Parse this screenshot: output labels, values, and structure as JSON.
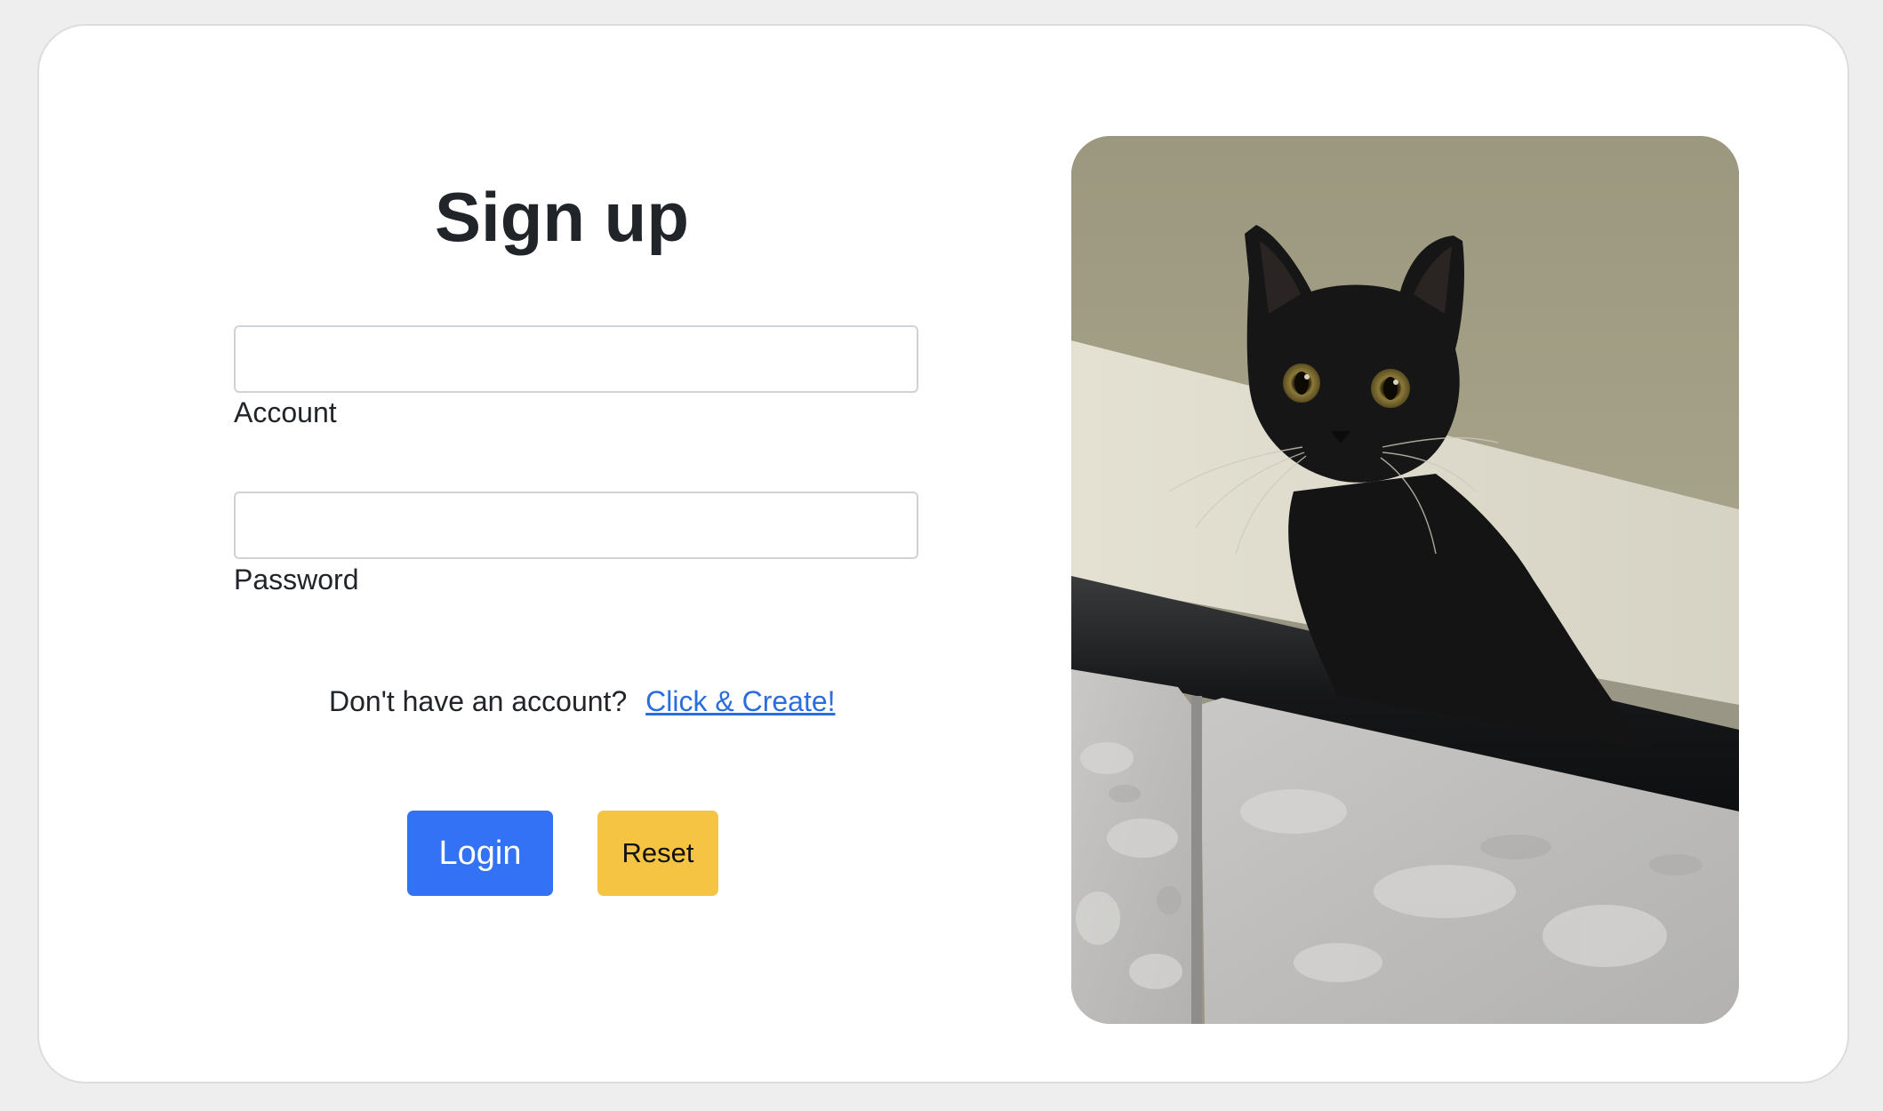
{
  "form": {
    "title": "Sign up",
    "account_label": "Account",
    "account_value": "",
    "password_label": "Password",
    "password_value": "",
    "no_account_text": "Don't have an account?",
    "create_link": "Click & Create!",
    "login_button": "Login",
    "reset_button": "Reset"
  },
  "photo": {
    "subject": "black-cat-photo"
  },
  "colors": {
    "primary": "#3372f5",
    "warning": "#f6c443",
    "link": "#2b6de0",
    "background": "#eeeeee"
  }
}
